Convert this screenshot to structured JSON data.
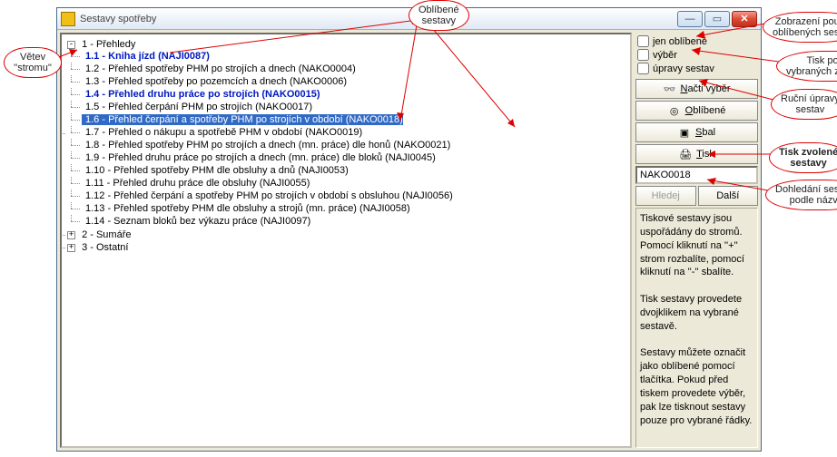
{
  "window": {
    "title": "Sestavy spotřeby"
  },
  "tree": {
    "root": {
      "num": "1",
      "label": "Přehledy",
      "expander": "-",
      "items": [
        {
          "text": "1.1 - Kniha jízd (NAJI0087)",
          "bold": true
        },
        {
          "text": "1.2 - Přehled spotřeby PHM po strojích a dnech (NAKO0004)"
        },
        {
          "text": "1.3 - Přehled spotřeby po pozemcích a dnech (NAKO0006)"
        },
        {
          "text": "1.4 - Přehled druhu práce po strojích (NAKO0015)",
          "bold": true
        },
        {
          "text": "1.5 - Přehled čerpání PHM po strojích (NAKO0017)"
        },
        {
          "text": "1.6 - Přehled čerpání a spotřeby PHM po strojích v období (NAKO0018)",
          "selected": true
        },
        {
          "text": "1.7 - Přehled o nákupu a spotřebě PHM v období (NAKO0019)"
        },
        {
          "text": "1.8 - Přehled spotřeby PHM po strojích a dnech (mn. práce) dle honů (NAKO0021)"
        },
        {
          "text": "1.9 - Přehled druhu práce po strojích a dnech (mn. práce) dle bloků (NAJI0045)"
        },
        {
          "text": "1.10 - Přehled spotřeby PHM dle obsluhy a dnů (NAJI0053)"
        },
        {
          "text": "1.11 - Přehled druhu práce dle obsluhy (NAJI0055)"
        },
        {
          "text": "1.12 - Přehled čerpání a spotřeby PHM po strojích v období s obsluhou (NAJI0056)"
        },
        {
          "text": "1.13 - Přehled spotřeby PHM dle obsluhy a strojů (mn. práce) (NAJI0058)"
        },
        {
          "text": "1.14 - Seznam bloků bez výkazu práce (NAJI0097)"
        }
      ]
    },
    "siblings": [
      {
        "num": "2",
        "label": "Sumáře",
        "expander": "+"
      },
      {
        "num": "3",
        "label": "Ostatní",
        "expander": "+"
      }
    ]
  },
  "checks": {
    "favorites": "jen oblíbené",
    "selection": "výběr",
    "edits": "úpravy sestav"
  },
  "buttons": {
    "load": "Načti výběr",
    "favorites": "Oblíbené",
    "collapse": "Sbal",
    "print": "Tisk"
  },
  "search": {
    "value": "NAKO0018",
    "find": "Hledej",
    "next": "Další"
  },
  "info": {
    "p1": "Tiskové sestavy jsou uspořádány do stromů. Pomocí kliknutí na ''+'' strom rozbalíte, pomocí kliknutí na ''-'' sbalíte.",
    "p2": "Tisk sestavy provedete dvojklikem na vybrané sestavě.",
    "p3": "Sestavy můžete označit jako oblíbené pomocí tlačítka. Pokud před tiskem provedete výběr, pak lze tisknout sestavy pouze pro vybrané řádky."
  },
  "callouts": {
    "favset": "Oblíbené\nsestavy",
    "showfav": "Zobrazení pouze\noblíbených sestav",
    "printsel": "Tisk pouze\nvybraných záznamů",
    "manedit": "Ruční úpravy\nsestav",
    "printchosen": "Tisk zvolené\nsestavy",
    "searchname": "Dohledání sestavy\npodle názvu",
    "branch": "Větev\n''stromu''"
  }
}
